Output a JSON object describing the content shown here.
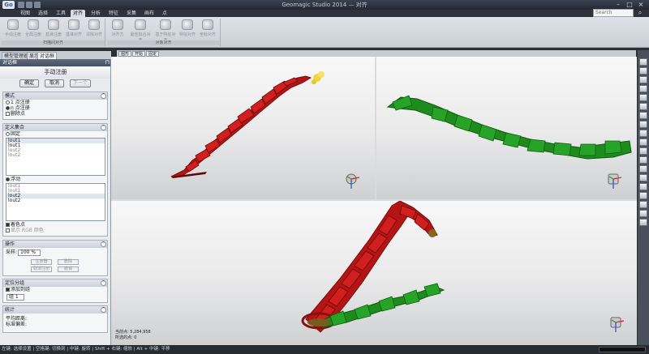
{
  "window": {
    "title": "Geomagic Studio 2014 — 对齐",
    "logo": "Go"
  },
  "ribbon": {
    "tabs": [
      "视图",
      "选择",
      "工具",
      "对齐",
      "分析",
      "特征",
      "采集",
      "画布",
      "点"
    ],
    "active_tab": "对齐",
    "search_placeholder": "Search",
    "groups": [
      {
        "label": "扫描间对齐",
        "buttons": [
          "手动注册",
          "全局注册",
          "基准注册",
          "基准对齐",
          "清除对齐"
        ]
      },
      {
        "label": "对象对齐",
        "buttons": [
          "对齐方",
          "最佳拟合对齐",
          "基于特征对齐",
          "特征对齐",
          "坐标对齐"
        ]
      }
    ]
  },
  "left_panel": {
    "tabs": [
      "模型管理器",
      "显示",
      "对话框"
    ],
    "active_tab": "对话框",
    "header": "对话框",
    "title": "手动注册",
    "buttons": {
      "ok": "确定",
      "cancel": "取消",
      "next": "下一个"
    },
    "mode": {
      "label": "模式",
      "options": [
        {
          "label": "1 点注册",
          "selected": false
        },
        {
          "label": "n 点注册",
          "selected": true
        },
        {
          "label": "删除点",
          "selected": false
        }
      ]
    },
    "define_set": {
      "label": "定义集合",
      "fixed_label": "固定",
      "fixed_items": [
        {
          "label": "lout1",
          "dim": false
        },
        {
          "label": "lout1",
          "dim": false
        },
        {
          "label": "lout2",
          "dim": true
        },
        {
          "label": "lout2",
          "dim": true
        }
      ],
      "floating_label": "浮动",
      "floating_items": [
        {
          "label": "lout1",
          "dim": true
        },
        {
          "label": "lout1",
          "dim": true
        },
        {
          "label": "lout2",
          "dim": false
        },
        {
          "label": "lout2",
          "dim": false
        }
      ],
      "color_points_label": "着色点",
      "rgb_label": "显示 RGB 颜色"
    },
    "operation": {
      "label": "操作",
      "sample_label": "采样:",
      "sample_value": "100 %",
      "register_label": "注册器",
      "delete_label": "删除",
      "remove_label": "取消注册",
      "undo_label": "撤销"
    },
    "grouping": {
      "label": "定位分组",
      "add_group_label": "添加到组",
      "group_value": "组 1"
    },
    "stats": {
      "label": "统计",
      "avg_label": "平均距离:",
      "std_label": "标准偏差:"
    }
  },
  "viewport": {
    "tabs": [
      "图形",
      "开始",
      "固定"
    ],
    "stats_points": "当前点: 5,284,958",
    "stats_selected": "所选的点: 0"
  },
  "status_bar": {
    "text": "左键: 选择设置 | 空格键: 切换到 | 中键: 旋转 | Shift + 右键: 缩放 | Alt + 中键: 平移"
  },
  "colors": {
    "fixed_scan": "#b51414",
    "floating_scan": "#1d8c1d",
    "highlight": "#f0d341",
    "ribbon_bg": "#d6dade",
    "chrome_dark": "#2d323c"
  },
  "icons": [
    "gear-icon",
    "search-icon",
    "minimize-icon",
    "maximize-icon",
    "close-icon",
    "axis-triad-icon",
    "pin-icon"
  ]
}
